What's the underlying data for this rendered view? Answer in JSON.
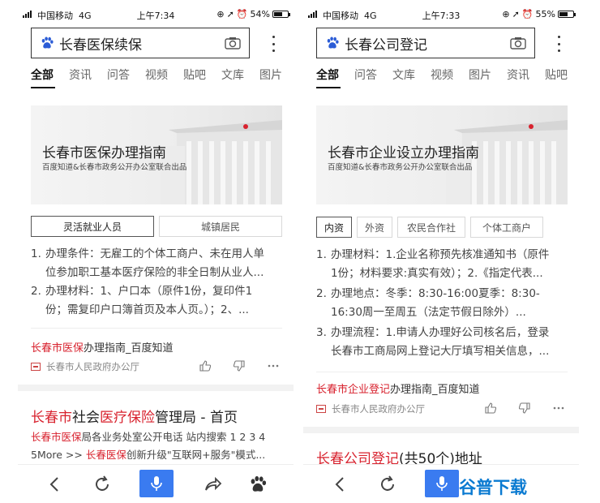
{
  "left": {
    "status": {
      "carrier": "中国移动",
      "network": "4G",
      "time": "上午7:34",
      "battery": "54%",
      "battery_level": 0.54
    },
    "search": {
      "query": "长春医保续保"
    },
    "tabs": [
      "全部",
      "资讯",
      "问答",
      "视频",
      "贴吧",
      "文库",
      "图片"
    ],
    "banner": {
      "title": "长春市医保办理指南",
      "subtitle": "百度知道&长春市政务公开办公室联合出品"
    },
    "chips": [
      "灵活就业人员",
      "城镇居民"
    ],
    "list": [
      {
        "num": "1.",
        "line1": "办理条件：无雇工的个体工商户、未在用人单",
        "line2": "位参加职工基本医疗保险的非全日制从业人..."
      },
      {
        "num": "2.",
        "line1": "办理材料：1、户口本（原件1份，复印件1",
        "line2": "份；需复印户口簿首页及本人页。）；2、..."
      }
    ],
    "result_title": {
      "red": "长春市医保",
      "rest": "办理指南_百度知道"
    },
    "source": "长春市人民政府办公厅",
    "result2": {
      "title_red1": "长春市",
      "title_mid1": "社会",
      "title_red2": "医疗保险",
      "title_mid2": "管理局 - 首页",
      "snippet1_red": "长春市医保",
      "snippet1_rest": "局各业务处室公开电话 站内搜索 1 2 3 4",
      "snippet2_pre": "5More >> ",
      "snippet2_red": "长春医保",
      "snippet2_rest": "创新升级\"互联网+服务\"模式..."
    }
  },
  "right": {
    "status": {
      "carrier": "中国移动",
      "network": "4G",
      "time": "上午7:33",
      "battery": "55%",
      "battery_level": 0.55
    },
    "search": {
      "query": "长春公司登记"
    },
    "tabs": [
      "全部",
      "问答",
      "文库",
      "视频",
      "图片",
      "资讯",
      "贴吧"
    ],
    "banner": {
      "title": "长春市企业设立办理指南",
      "subtitle": "百度知道&长春市政务公开办公室联合出品"
    },
    "chips": [
      "内资",
      "外资",
      "农民合作社",
      "个体工商户"
    ],
    "list": [
      {
        "num": "1.",
        "line1": "办理材料：1.企业名称预先核准通知书（原件",
        "line2": "1份；材料要求:真实有效）；2.《指定代表..."
      },
      {
        "num": "2.",
        "line1": "办理地点：冬季：8:30-16:00夏季：8:30-",
        "line2": "16:30周一至周五（法定节假日除外）..."
      },
      {
        "num": "3.",
        "line1": "办理流程：1.申请人办理好公司核名后，登录",
        "line2": "长春市工商局网上登记大厅填写相关信息，..."
      }
    ],
    "result_title": {
      "red": "长春市企业登记",
      "rest": "办理指南_百度知道"
    },
    "source": "长春市人民政府办公厅",
    "result2": {
      "title_red": "长春公司登记",
      "title_rest": "(共50个)地址"
    }
  },
  "watermark": "谷普下载",
  "colors": {
    "accent_red": "#d8222e",
    "mic_blue": "#3a7bf0"
  }
}
